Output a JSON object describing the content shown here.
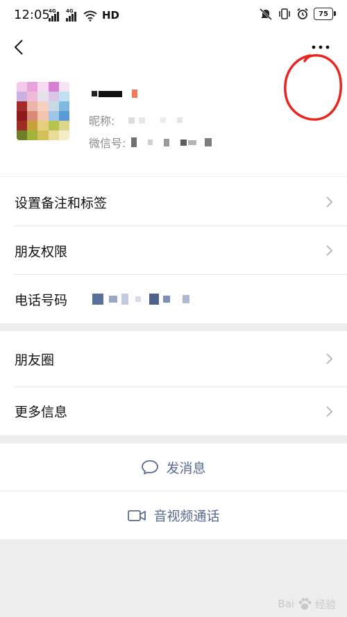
{
  "status_bar": {
    "time": "12:05",
    "network_tag_1": "4G",
    "network_tag_2": "4G",
    "hd_label": "HD",
    "battery_level": "75"
  },
  "profile": {
    "nickname_label": "昵称:",
    "wechat_id_label": "微信号:"
  },
  "menu": {
    "remark_tags": "设置备注和标签",
    "friend_permissions": "朋友权限",
    "phone_number": "电话号码",
    "moments": "朋友圈",
    "more_info": "更多信息"
  },
  "actions": {
    "send_message": "发消息",
    "av_call": "音视频通话"
  },
  "watermark": {
    "brand": "Bai",
    "brand_suffix": "经验"
  },
  "colors": {
    "link_blue": "#576b95",
    "annotation_red": "#e8261f",
    "page_bg": "#ededed"
  }
}
